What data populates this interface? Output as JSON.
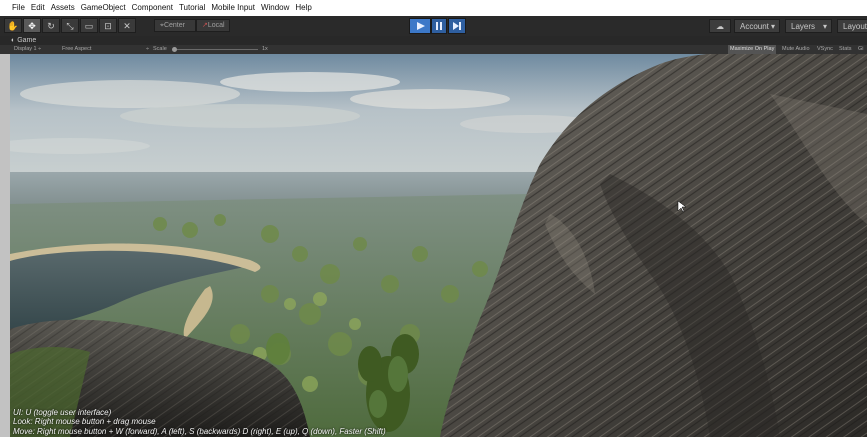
{
  "menubar": {
    "items": [
      "File",
      "Edit",
      "Assets",
      "GameObject",
      "Component",
      "Tutorial",
      "Mobile Input",
      "Window",
      "Help"
    ]
  },
  "toolbar": {
    "tools": [
      {
        "name": "hand-tool",
        "glyph": "✋"
      },
      {
        "name": "move-tool",
        "glyph": "✥"
      },
      {
        "name": "rotate-tool",
        "glyph": "↻"
      },
      {
        "name": "scale-tool",
        "glyph": "⤡"
      },
      {
        "name": "rect-tool",
        "glyph": "▭"
      },
      {
        "name": "transform-tool",
        "glyph": "⊡"
      },
      {
        "name": "custom-tool",
        "glyph": "✕"
      }
    ],
    "active_tool": 1,
    "pivot_label": "Center",
    "rotation_label": "Local",
    "account_label": "Account",
    "layers_label": "Layers",
    "layout_label": "Layout",
    "play_color": "#3c78c8"
  },
  "game_view": {
    "tab_label": "Game",
    "display_label": "Display 1",
    "aspect_label": "Free Aspect",
    "scale_label": "Scale",
    "scale_value": "1x",
    "maximize_label": "Maximize On Play",
    "mute_label": "Mute Audio",
    "vsync_label": "VSync",
    "stats_label": "Stats",
    "gizmos_label": "Gi"
  },
  "hud": {
    "lines": [
      "UI: U (toggle user interface)",
      "Look: Right mouse button + drag mouse",
      "Move: Right mouse button + W (forward), A (left), S (backwards) D (right), E (up), Q (down), Faster (Shift)"
    ]
  }
}
